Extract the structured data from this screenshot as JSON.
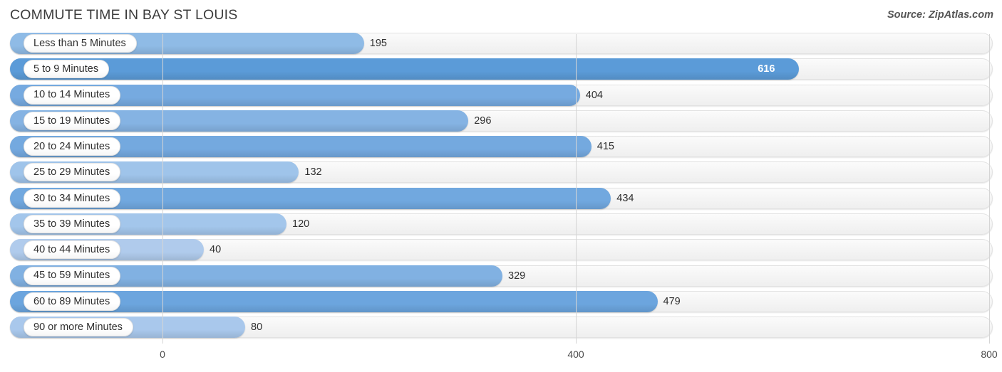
{
  "header": {
    "title": "COMMUTE TIME IN BAY ST LOUIS",
    "source": "Source: ZipAtlas.com"
  },
  "axis": {
    "ticks": [
      "0",
      "400",
      "800"
    ],
    "min": 0,
    "max": 800
  },
  "colors": {
    "bar_dark": "#5b9bd8",
    "bar_mid": "#76aae0",
    "bar_light": "#95bfe8",
    "bar_lightest": "#b0cbec",
    "track": "#f4f4f4",
    "gridline": "#d5d5d5",
    "value_text": "#2f2f2f",
    "value_text_inside": "#ffffff"
  },
  "chart_data": {
    "type": "bar",
    "orientation": "horizontal",
    "title": "COMMUTE TIME IN BAY ST LOUIS",
    "xlabel": "",
    "ylabel": "",
    "xlim": [
      0,
      800
    ],
    "xticks": [
      0,
      400,
      800
    ],
    "grid": true,
    "legend": null,
    "source": "Source: ZipAtlas.com",
    "categories": [
      "Less than 5 Minutes",
      "5 to 9 Minutes",
      "10 to 14 Minutes",
      "15 to 19 Minutes",
      "20 to 24 Minutes",
      "25 to 29 Minutes",
      "30 to 34 Minutes",
      "35 to 39 Minutes",
      "40 to 44 Minutes",
      "45 to 59 Minutes",
      "60 to 89 Minutes",
      "90 or more Minutes"
    ],
    "values": [
      195,
      616,
      404,
      296,
      415,
      132,
      434,
      120,
      40,
      329,
      479,
      80
    ],
    "value_labels": [
      "195",
      "616",
      "404",
      "296",
      "415",
      "132",
      "434",
      "120",
      "40",
      "329",
      "479",
      "80"
    ]
  },
  "rows": [
    {
      "label": "Less than 5 Minutes",
      "value": 195,
      "value_label": "195",
      "color": "#8fbbe6",
      "inside": false
    },
    {
      "label": "5 to 9 Minutes",
      "value": 616,
      "value_label": "616",
      "color": "#5b9bd8",
      "inside": true
    },
    {
      "label": "10 to 14 Minutes",
      "value": 404,
      "value_label": "404",
      "color": "#76aae0",
      "inside": false
    },
    {
      "label": "15 to 19 Minutes",
      "value": 296,
      "value_label": "296",
      "color": "#85b3e3",
      "inside": false
    },
    {
      "label": "20 to 24 Minutes",
      "value": 415,
      "value_label": "415",
      "color": "#74a9df",
      "inside": false
    },
    {
      "label": "25 to 29 Minutes",
      "value": 132,
      "value_label": "132",
      "color": "#9fc4ea",
      "inside": false
    },
    {
      "label": "30 to 34 Minutes",
      "value": 434,
      "value_label": "434",
      "color": "#71a8df",
      "inside": false
    },
    {
      "label": "35 to 39 Minutes",
      "value": 120,
      "value_label": "120",
      "color": "#a3c6eb",
      "inside": false
    },
    {
      "label": "40 to 44 Minutes",
      "value": 40,
      "value_label": "40",
      "color": "#b0cbec",
      "inside": false
    },
    {
      "label": "45 to 59 Minutes",
      "value": 329,
      "value_label": "329",
      "color": "#81b1e2",
      "inside": false
    },
    {
      "label": "60 to 89 Minutes",
      "value": 479,
      "value_label": "479",
      "color": "#6ca5de",
      "inside": false
    },
    {
      "label": "90 or more Minutes",
      "value": 80,
      "value_label": "80",
      "color": "#a9c8ec",
      "inside": false
    }
  ]
}
